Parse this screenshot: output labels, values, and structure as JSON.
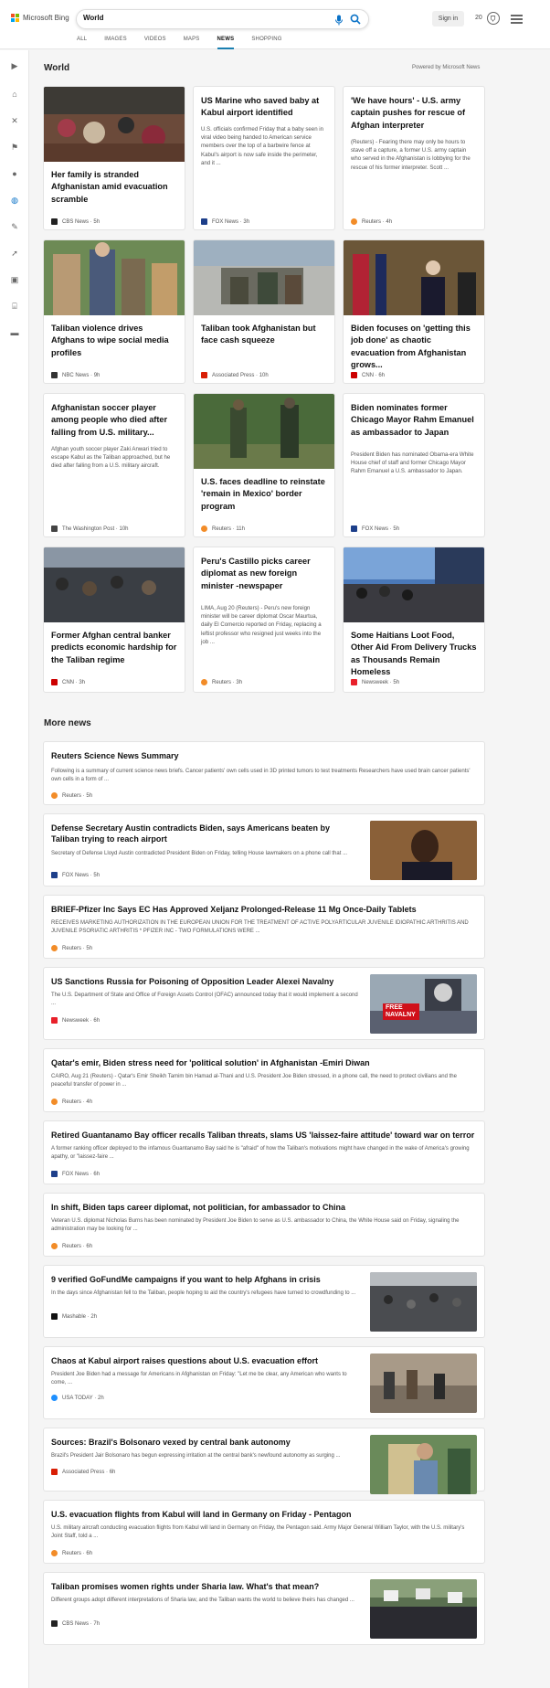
{
  "header": {
    "logo_text": "Microsoft Bing",
    "search_value": "World",
    "signin_label": "Sign in",
    "rewards_count": "20",
    "colors": {
      "logo_red": "#f25022",
      "logo_green": "#7fba00",
      "logo_blue": "#00a4ef",
      "logo_yellow": "#ffb900",
      "accent": "#1a7fb0"
    }
  },
  "tabs": [
    "ALL",
    "IMAGES",
    "VIDEOS",
    "MAPS",
    "NEWS",
    "SHOPPING"
  ],
  "active_tab": "NEWS",
  "sidebar": {
    "icons": [
      "chevron-right-icon",
      "home-icon",
      "sports-icon",
      "flag-icon",
      "location-pin-icon",
      "globe-icon",
      "microscope-icon",
      "rocket-icon",
      "film-icon",
      "bank-icon",
      "car-icon"
    ],
    "active": "globe-icon"
  },
  "world": {
    "heading": "World",
    "powered_by": "Powered by Microsoft News",
    "cards": [
      {
        "title": "Her family is stranded Afghanistan amid evacuation scramble",
        "desc": "",
        "source": "CBS News",
        "time": "5h",
        "has_image": true,
        "logo": "#222222"
      },
      {
        "title": "US Marine who saved baby at Kabul airport identified",
        "desc": "U.S. officials confirmed Friday that a baby seen in viral video being handed to American service members over the top of a barbwire fence at Kabul's airport is now safe inside the perimeter, and it ...",
        "source": "FOX News",
        "time": "3h",
        "has_image": false,
        "logo": "#1d3f8a"
      },
      {
        "title": "'We have hours' - U.S. army captain pushes for rescue of Afghan interpreter",
        "desc": "(Reuters) - Fearing there may only be hours to stave off a capture, a former U.S. army captain who served in the Afghanistan is lobbying for the rescue of his former interpreter.     Scott ...",
        "source": "Reuters",
        "time": "4h",
        "has_image": false,
        "logo": "#f28c28"
      },
      {
        "title": "Taliban violence drives Afghans to wipe social media profiles",
        "desc": "",
        "source": "NBC News",
        "time": "9h",
        "has_image": true,
        "logo": "#333333"
      },
      {
        "title": "Taliban took Afghanistan but face cash squeeze",
        "desc": "",
        "source": "Associated Press",
        "time": "10h",
        "has_image": true,
        "logo": "#d81e05"
      },
      {
        "title": "Biden focuses on 'getting this job done' as chaotic evacuation from Afghanistan grows...",
        "desc": "",
        "source": "CNN",
        "time": "6h",
        "has_image": true,
        "logo": "#cc0000"
      },
      {
        "title": "Afghanistan soccer player among people who died after falling from U.S. military...",
        "desc": "Afghan youth soccer player Zaki Anwari tried to escape Kabul as the Taliban approached, but he died after falling from a U.S. military aircraft.",
        "source": "The Washington Post",
        "time": "10h",
        "has_image": false,
        "logo": "#444444"
      },
      {
        "title": "U.S. faces deadline to reinstate 'remain in Mexico' border program",
        "desc": "",
        "source": "Reuters",
        "time": "11h",
        "has_image": true,
        "logo": "#f28c28"
      },
      {
        "title": "Biden nominates former Chicago Mayor Rahm Emanuel as ambassador to Japan",
        "desc": "President Biden has nominated Obama-era White House chief of staff and former Chicago Mayor Rahm Emanuel a U.S. ambassador to Japan.",
        "source": "FOX News",
        "time": "5h",
        "has_image": false,
        "logo": "#1d3f8a"
      },
      {
        "title": "Former Afghan central banker predicts economic hardship for the Taliban regime",
        "desc": "",
        "source": "CNN",
        "time": "3h",
        "has_image": true,
        "logo": "#cc0000"
      },
      {
        "title": "Peru's Castillo picks career diplomat as new foreign minister -newspaper",
        "desc": "LIMA, Aug 20 (Reuters) - Peru's new foreign minister will be career diplomat Oscar Maurtua, daily El Comercio reported on Friday, replacing a leftist professor who resigned just weeks into the job ...",
        "source": "Reuters",
        "time": "3h",
        "has_image": false,
        "logo": "#f28c28"
      },
      {
        "title": "Some Haitians Loot Food, Other Aid From Delivery Trucks as Thousands Remain Homeless",
        "desc": "",
        "source": "Newsweek",
        "time": "5h",
        "has_image": true,
        "logo": "#e8202a"
      }
    ]
  },
  "more_news": {
    "heading": "More news",
    "items": [
      {
        "title": "Reuters Science News Summary",
        "desc": "Following is a summary of current science news briefs. Cancer patients' own cells used in 3D printed tumors to test treatments Researchers have used brain cancer patients' own cells in a form of ...",
        "source": "Reuters",
        "time": "5h",
        "has_image": false,
        "logo": "#f28c28"
      },
      {
        "title": "Defense Secretary Austin contradicts Biden, says Americans beaten by Taliban trying to reach airport",
        "desc": "Secretary of Defense Lloyd Austin contradicted President Biden on Friday, telling House lawmakers on a phone call that ...",
        "source": "FOX News",
        "time": "5h",
        "has_image": true,
        "logo": "#1d3f8a"
      },
      {
        "title": "BRIEF-Pfizer Inc Says EC Has Approved Xeljanz Prolonged-Release 11 Mg Once-Daily Tablets",
        "desc": "RECEIVES MARKETING AUTHORIZATION IN THE EUROPEAN UNION FOR THE TREATMENT OF ACTIVE POLYARTICULAR JUVENILE IDIOPATHIC ARTHRITIS AND JUVENILE PSORIATIC ARTHRITIS * PFIZER INC - TWO FORMULATIONS WERE ...",
        "source": "Reuters",
        "time": "5h",
        "has_image": false,
        "logo": "#f28c28"
      },
      {
        "title": "US Sanctions Russia for Poisoning of Opposition Leader Alexei Navalny",
        "desc": "The U.S. Department of State and Office of Foreign Assets Control (OFAC) announced today that it would implement a second ...",
        "source": "Newsweek",
        "time": "6h",
        "has_image": true,
        "logo": "#e8202a",
        "image_text": "FREE NAVALNY"
      },
      {
        "title": "Qatar's emir, Biden stress need for 'political solution' in Afghanistan -Emiri Diwan",
        "desc": "CAIRO, Aug 21 (Reuters) - Qatar's Emir Sheikh Tamim bin Hamad al-Thani and U.S. President Joe Biden stressed, in a phone call, the need to protect civilians and the peaceful transfer of power in ...",
        "source": "Reuters",
        "time": "4h",
        "has_image": false,
        "logo": "#f28c28"
      },
      {
        "title": "Retired Guantanamo Bay officer recalls Taliban threats, slams US 'laissez-faire attitude' toward war on terror",
        "desc": "A former ranking officer deployed to the infamous Guantanamo Bay said he is \"afraid\" of how the Taliban's motivations might have changed in the wake of America's growing apathy, or \"laissez-faire ...",
        "source": "FOX News",
        "time": "6h",
        "has_image": false,
        "logo": "#1d3f8a"
      },
      {
        "title": "In shift, Biden taps career diplomat, not politician, for ambassador to China",
        "desc": "Veteran U.S. diplomat Nicholas Burns has been nominated by President Joe Biden to serve as U.S. ambassador to China, the White House said on Friday, signaling the administration may be looking for ...",
        "source": "Reuters",
        "time": "6h",
        "has_image": false,
        "logo": "#f28c28"
      },
      {
        "title": "9 verified GoFundMe campaigns if you want to help Afghans in crisis",
        "desc": "In the days since Afghanistan fell to the Taliban, people hoping to aid the country's refugees have turned to crowdfunding to ...",
        "source": "Mashable",
        "time": "2h",
        "has_image": true,
        "logo": "#111111"
      },
      {
        "title": "Chaos at Kabul airport raises questions about U.S. evacuation effort",
        "desc": "President Joe Biden had a message for Americans in Afghanistan on Friday: \"Let me be clear, any American who wants to come, ...",
        "source": "USA TODAY",
        "time": "2h",
        "has_image": true,
        "logo": "#1e90ff"
      },
      {
        "title": "Sources: Brazil's Bolsonaro vexed by central bank autonomy",
        "desc": "Brazil's President Jair Bolsonaro has begun expressing irritation at the central bank's newfound autonomy as surging ...",
        "source": "Associated Press",
        "time": "6h",
        "has_image": true,
        "logo": "#d81e05"
      },
      {
        "title": "U.S. evacuation flights from Kabul will land in Germany on Friday - Pentagon",
        "desc": "U.S. military aircraft conducting evacuation flights from Kabul will land in Germany on Friday, the Pentagon said. Army Major General William Taylor, with the U.S. military's Joint Staff, told a ...",
        "source": "Reuters",
        "time": "6h",
        "has_image": false,
        "logo": "#f28c28"
      },
      {
        "title": "Taliban promises women rights under Sharia law. What's that mean?",
        "desc": "Different groups adopt different interpretations of Sharia law, and the Taliban wants the world to believe theirs has changed ...",
        "source": "CBS News",
        "time": "7h",
        "has_image": true,
        "logo": "#222222"
      }
    ]
  }
}
